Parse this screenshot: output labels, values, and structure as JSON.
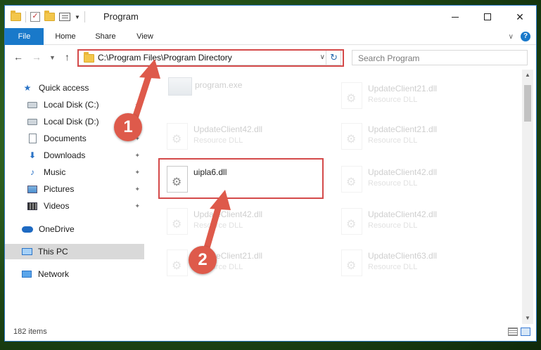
{
  "window": {
    "title": "Program"
  },
  "ribbon": {
    "tabs": [
      "File",
      "Home",
      "Share",
      "View"
    ]
  },
  "address": {
    "path": "C:\\Program Files\\Program Directory",
    "search_placeholder": "Search Program"
  },
  "nav": {
    "items": [
      {
        "label": "Quick access",
        "icon": "star-icon"
      },
      {
        "label": "Local Disk (C:)",
        "icon": "disk-icon",
        "pinned": true
      },
      {
        "label": "Local Disk (D:)",
        "icon": "disk-icon",
        "pinned": true
      },
      {
        "label": "Documents",
        "icon": "documents-icon",
        "pinned": true
      },
      {
        "label": "Downloads",
        "icon": "downloads-icon",
        "pinned": true
      },
      {
        "label": "Music",
        "icon": "music-icon",
        "pinned": true
      },
      {
        "label": "Pictures",
        "icon": "pictures-icon",
        "pinned": true
      },
      {
        "label": "Videos",
        "icon": "videos-icon",
        "pinned": true
      },
      {
        "label": "OneDrive",
        "icon": "onedrive-icon"
      },
      {
        "label": "This PC",
        "icon": "this-pc-icon",
        "selected": true
      },
      {
        "label": "Network",
        "icon": "network-icon"
      }
    ]
  },
  "files": {
    "left": [
      {
        "name": "program.exe",
        "type": ""
      },
      {
        "name": "UpdateClient42.dll",
        "type": "Resource DLL"
      },
      {
        "name": "uipla6.dll",
        "type": ""
      },
      {
        "name": "UpdateClient42.dll",
        "type": "Resource DLL"
      },
      {
        "name": "UpdateClient21.dll",
        "type": "Resource DLL"
      }
    ],
    "right": [
      {
        "name": "UpdateClient21.dll",
        "type": "Resource DLL"
      },
      {
        "name": "UpdateClient21.dll",
        "type": "Resource DLL"
      },
      {
        "name": "UpdateClient42.dll",
        "type": "Resource DLL"
      },
      {
        "name": "UpdateClient42.dll",
        "type": "Resource DLL"
      },
      {
        "name": "UpdateClient63.dll",
        "type": "Resource DLL"
      }
    ]
  },
  "status": {
    "item_count": "182 items"
  },
  "annotations": {
    "step1": "1",
    "step2": "2",
    "highlight_color": "#d44a4a",
    "badge_color": "#de5a4b"
  },
  "colors": {
    "accent": "#1979ca"
  }
}
